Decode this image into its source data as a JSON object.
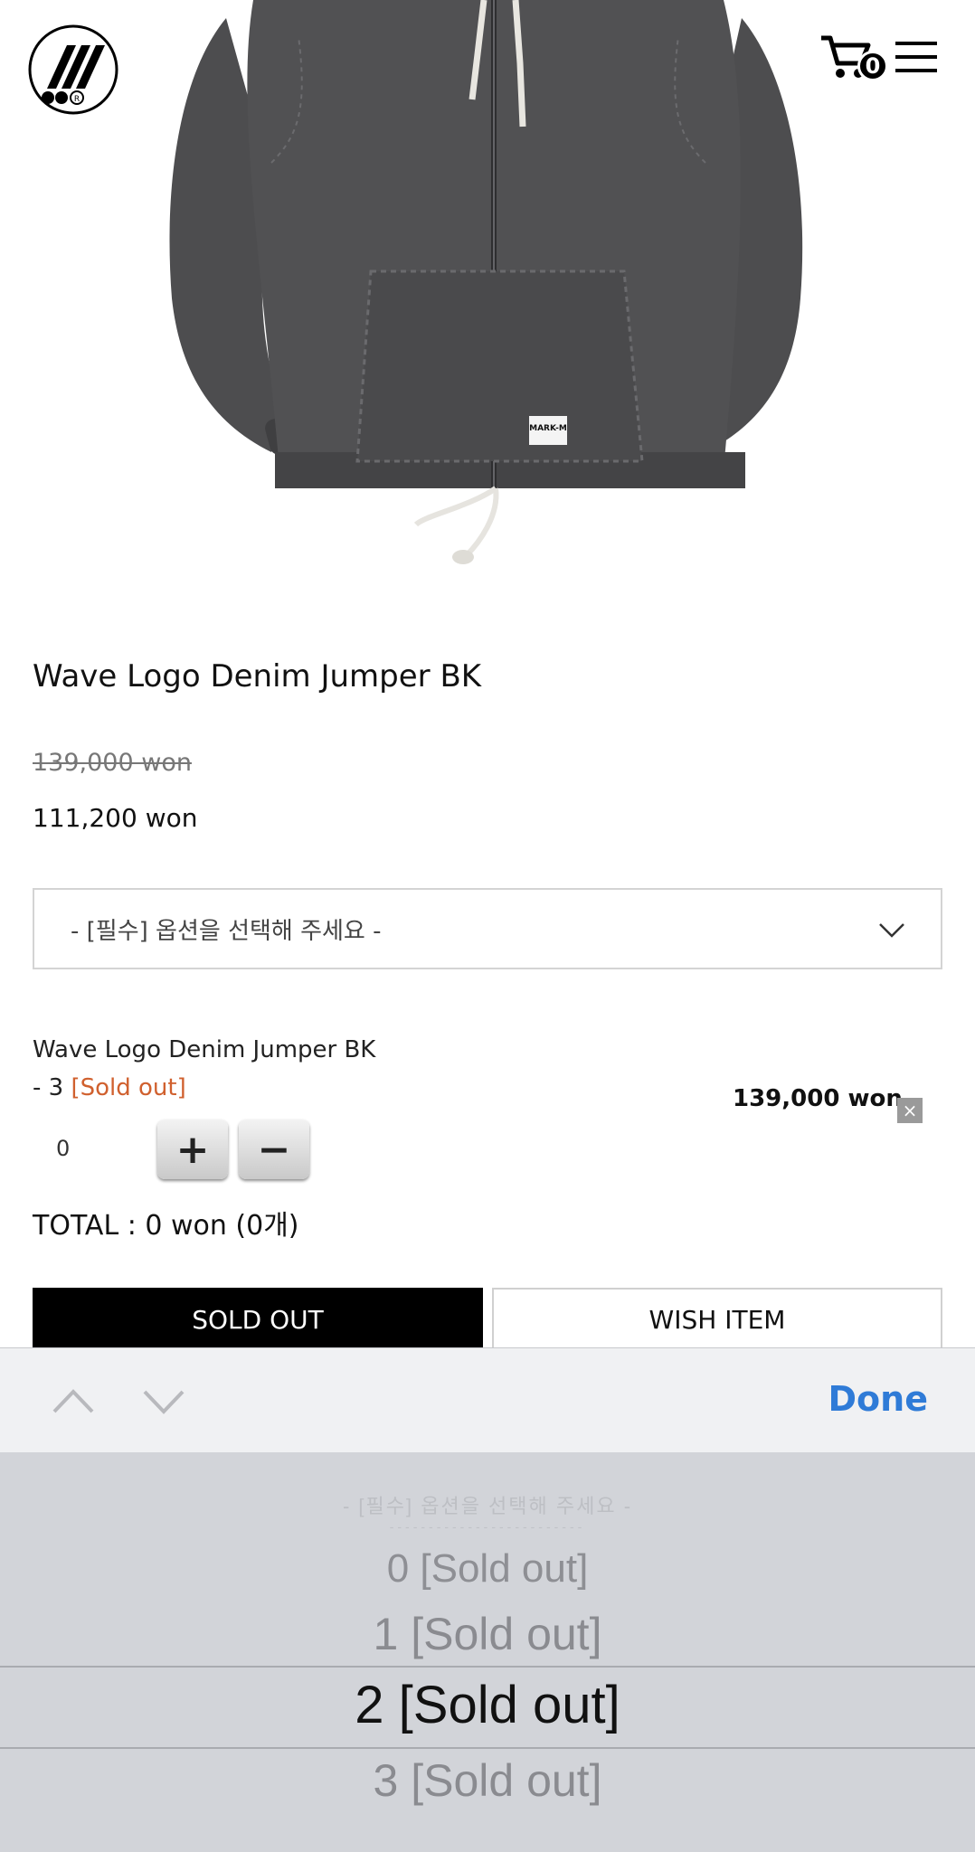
{
  "header": {
    "logo_icon": "brand-logo-icon",
    "cart_count": "0",
    "cart_icon": "cart-icon",
    "menu_icon": "hamburger-menu-icon"
  },
  "product": {
    "title": "Wave Logo Denim Jumper BK",
    "original_price": "139,000 won",
    "sale_price": "111,200 won",
    "image_label": "MARK-M"
  },
  "option_select": {
    "placeholder": "- [필수] 옵션을 선택해 주세요 -"
  },
  "selected_option": {
    "name": "Wave Logo Denim Jumper BK",
    "size_prefix": "- 3 ",
    "status": "[Sold out]",
    "price": "139,000 won",
    "quantity": "0",
    "plus_label": "+",
    "minus_label": "−",
    "remove_label": "×"
  },
  "total": "TOTAL : 0 won (0개)",
  "buttons": {
    "sold_out": "SOLD OUT",
    "wish": "WISH ITEM"
  },
  "toolbar": {
    "done_label": "Done"
  },
  "picker": {
    "ghost_top": "- [필수] 옵션을 선택해 주세요 -",
    "ghost_line": "-------------------------",
    "items": [
      "0 [Sold out]",
      "1 [Sold out]",
      "2 [Sold out]",
      "3 [Sold out]"
    ],
    "selected_index": 2
  },
  "colors": {
    "accent_done": "#2f7bd7",
    "sold_out_text": "#d0602e",
    "picker_bg": "#d2d4d9"
  }
}
